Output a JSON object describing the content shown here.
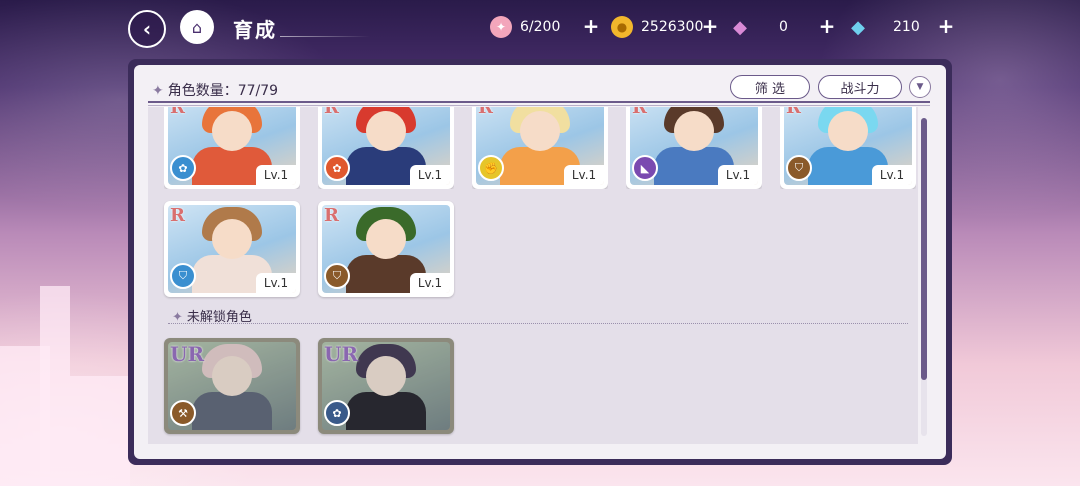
{
  "header": {
    "title": "育成",
    "back_icon": "back-arrow-icon",
    "home_icon": "castle-home-icon"
  },
  "resources": [
    {
      "name": "candy",
      "icon": "candy-icon",
      "value": "6/200",
      "color": "#e8708a"
    },
    {
      "name": "gold",
      "icon": "coin-icon",
      "value": "2526300",
      "color": "#f2b72c"
    },
    {
      "name": "pink-gem",
      "icon": "pink-diamond-icon",
      "value": "0",
      "color": "#d98ad6"
    },
    {
      "name": "blue-gem",
      "icon": "blue-diamond-icon",
      "value": "210",
      "color": "#6fd0ee"
    }
  ],
  "panel": {
    "count_label": "角色数量：77/79",
    "filter_label": "筛 选",
    "power_label": "战斗力",
    "locked_section_label": "未解锁角色"
  },
  "cards_row1": [
    {
      "rarity": "R",
      "level": "Lv.1",
      "attr_color": "#3a8fd0",
      "attr_icon": "paw-icon",
      "hair": "#e8743a",
      "outfit": "#e05a3a"
    },
    {
      "rarity": "R",
      "level": "Lv.1",
      "attr_color": "#e0582e",
      "attr_icon": "paw-icon",
      "hair": "#d83a2e",
      "outfit": "#2a3c7a"
    },
    {
      "rarity": "R",
      "level": "Lv.1",
      "attr_color": "#e6c52a",
      "attr_icon": "fist-icon",
      "hair": "#f1dfa0",
      "outfit": "#f3a04a"
    },
    {
      "rarity": "R",
      "level": "Lv.1",
      "attr_color": "#7a4ab0",
      "attr_icon": "boot-icon",
      "hair": "#5a3a2a",
      "outfit": "#4a7ac0"
    },
    {
      "rarity": "R",
      "level": "Lv.1",
      "attr_color": "#8a5a2a",
      "attr_icon": "shield-icon",
      "hair": "#7ad8f0",
      "outfit": "#4a9ad8"
    }
  ],
  "cards_row2": [
    {
      "rarity": "R",
      "level": "Lv.1",
      "attr_color": "#3a8fd0",
      "attr_icon": "shield-icon",
      "hair": "#b07a4a",
      "outfit": "#f0e0d8"
    },
    {
      "rarity": "R",
      "level": "Lv.1",
      "attr_color": "#8a5a2a",
      "attr_icon": "shield-icon",
      "hair": "#3a6a2a",
      "outfit": "#5a3a2a"
    }
  ],
  "locked_cards": [
    {
      "rarity": "UR",
      "attr_color": "#8a5a2a",
      "attr_icon": "wrench-icon",
      "hair": "#f0c8c8",
      "outfit": "#5a6a8a"
    },
    {
      "rarity": "UR",
      "attr_color": "#3a5a8a",
      "attr_icon": "paw-icon",
      "hair": "#4a3a6a",
      "outfit": "#2a2a3a"
    }
  ]
}
